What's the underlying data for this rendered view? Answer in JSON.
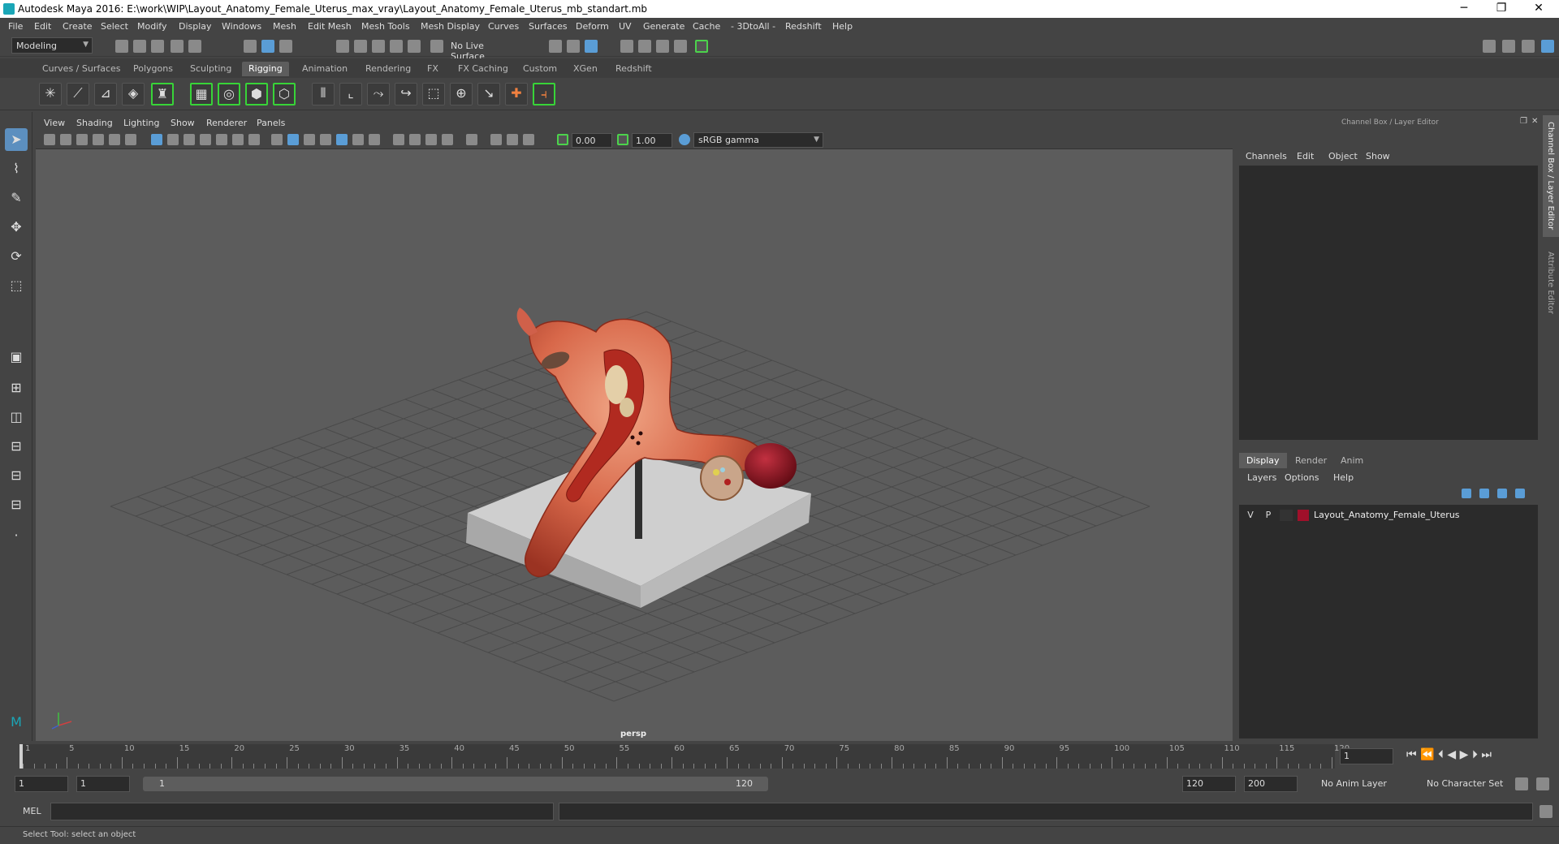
{
  "window": {
    "title": "Autodesk Maya 2016: E:\\work\\WIP\\Layout_Anatomy_Female_Uterus_max_vray\\Layout_Anatomy_Female_Uterus_mb_standart.mb",
    "minimize": "─",
    "maximize": "❐",
    "close": "✕"
  },
  "menubar": [
    "File",
    "Edit",
    "Create",
    "Select",
    "Modify",
    "Display",
    "Windows",
    "Mesh",
    "Edit Mesh",
    "Mesh Tools",
    "Mesh Display",
    "Curves",
    "Surfaces",
    "Deform",
    "UV",
    "Generate",
    "Cache",
    "- 3DtoAll -",
    "Redshift",
    "Help"
  ],
  "statusline": {
    "mode": "Modeling",
    "live_surface": "No Live Surface"
  },
  "shelf_tabs": [
    "Curves / Surfaces",
    "Polygons",
    "Sculpting",
    "Rigging",
    "Animation",
    "Rendering",
    "FX",
    "FX Caching",
    "Custom",
    "XGen",
    "Redshift"
  ],
  "shelf_active": "Rigging",
  "viewport": {
    "menu": [
      "View",
      "Shading",
      "Lighting",
      "Show",
      "Renderer",
      "Panels"
    ],
    "exposure": "0.00",
    "gamma": "1.00",
    "color_space": "sRGB gamma",
    "camera": "persp"
  },
  "channel_box": {
    "title": "Channel Box / Layer Editor",
    "menu": [
      "Channels",
      "Edit",
      "Object",
      "Show"
    ]
  },
  "layer_editor": {
    "tabs": [
      "Display",
      "Render",
      "Anim"
    ],
    "active_tab": "Display",
    "menu": [
      "Layers",
      "Options",
      "Help"
    ],
    "layers": [
      {
        "v": "V",
        "p": "P",
        "color": "#a0102a",
        "name": "Layout_Anatomy_Female_Uterus"
      }
    ]
  },
  "side_tabs": [
    "Channel Box / Layer Editor",
    "Attribute Editor"
  ],
  "timeline": {
    "ticks": [
      1,
      5,
      10,
      15,
      20,
      25,
      30,
      35,
      40,
      45,
      50,
      55,
      60,
      65,
      70,
      75,
      80,
      85,
      90,
      95,
      100,
      105,
      110,
      115,
      120
    ],
    "current_frame": "1"
  },
  "range": {
    "start": "1",
    "playback_start": "1",
    "slider_start": "1",
    "slider_end": "120",
    "playback_end": "120",
    "end": "200",
    "anim_layer": "No Anim Layer",
    "character_set": "No Character Set"
  },
  "cmdline": {
    "label": "MEL"
  },
  "help_line": "Select Tool: select an object",
  "colors": {
    "accent": "#5c8fbf",
    "shelf_highlight": "#38d438",
    "layer_color": "#a0102a"
  }
}
